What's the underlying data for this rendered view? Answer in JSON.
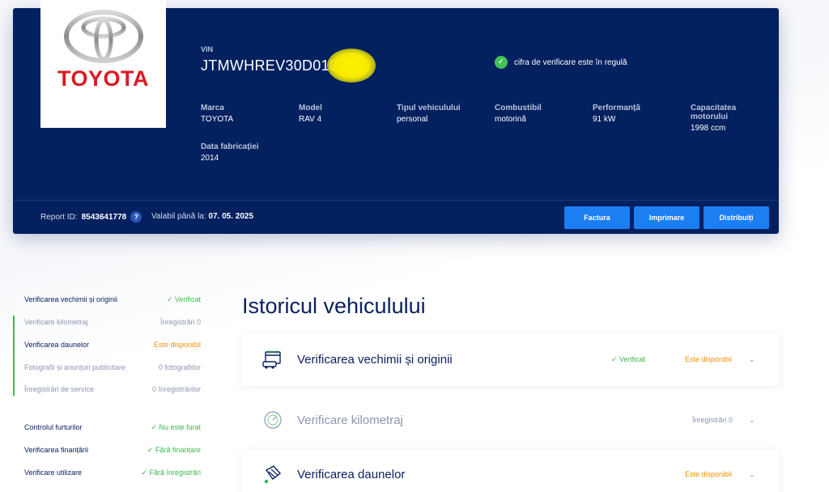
{
  "brand": {
    "name": "TOYOTA",
    "color": "#d81b23"
  },
  "vehicle": {
    "vin_label": "VIN",
    "vin_value": "JTMWHREV30D010",
    "check_text": "cifra de verificare este în regulă",
    "specs": [
      {
        "label": "Marca",
        "value": "TOYOTA"
      },
      {
        "label": "Model",
        "value": "RAV 4"
      },
      {
        "label": "Tipul vehiculului",
        "value": "personal"
      },
      {
        "label": "Combustibil",
        "value": "motorină"
      },
      {
        "label": "Performanță",
        "value": "91 kW"
      },
      {
        "label": "Capacitatea motorului",
        "value": "1998 ccm"
      },
      {
        "label": "Data fabricației",
        "value": "2014"
      }
    ]
  },
  "report": {
    "id_label": "Report ID:",
    "id_value": "8543641778",
    "help_glyph": "?",
    "valid_label": "Valabil până la:",
    "valid_value": "07. 05. 2025"
  },
  "actions": {
    "invoice": "Factura",
    "print": "Imprimare",
    "share": "Distribuiți"
  },
  "sidebar": {
    "items": [
      {
        "name": "Verificarea vechimii și originii",
        "value": "✓ Verificat",
        "tone": "green"
      },
      {
        "name": "Verificare kilometraj",
        "value": "Înregistrări 0",
        "tone": "muted"
      },
      {
        "name": "Verificarea daunelor",
        "value": "Este disponibil",
        "tone": "orange"
      },
      {
        "name": "Fotografii și anunțuri publicitare",
        "value": "0 fotografiilor",
        "tone": "muted"
      },
      {
        "name": "Înregistrări de service",
        "value": "0 înregistrărilor",
        "tone": "muted"
      },
      {
        "name": "Controlul furturilor",
        "value": "✓ Nu este furat",
        "tone": "green"
      },
      {
        "name": "Verificarea finanțării",
        "value": "✓ Fără finanțare",
        "tone": "green"
      },
      {
        "name": "Verificare utilizare",
        "value": "✓ Fără înregistrări",
        "tone": "green"
      }
    ]
  },
  "main": {
    "title": "Istoricul vehiculului",
    "sections": [
      {
        "title": "Verificarea vechimii și originii",
        "status1": "✓ Verificat",
        "status2": "Este disponibil",
        "chevron": "⌄"
      },
      {
        "title": "Verificare kilometraj",
        "status1": "",
        "status2": "Înregistrări 0",
        "chevron": "⌄"
      },
      {
        "title": "Verificarea daunelor",
        "status1": "",
        "status2": "Este disponibil",
        "chevron": "⌄"
      }
    ]
  },
  "colors": {
    "navy": "#03205f",
    "accent_blue": "#1b7ff2",
    "ok_green": "#3cb84f",
    "warn_orange": "#f29100"
  },
  "icons": {
    "check": "check-icon",
    "help": "help-icon",
    "chevron": "chevron-down-icon",
    "age": "calendar-car-icon",
    "odometer": "odometer-icon",
    "damage": "damaged-car-icon"
  }
}
